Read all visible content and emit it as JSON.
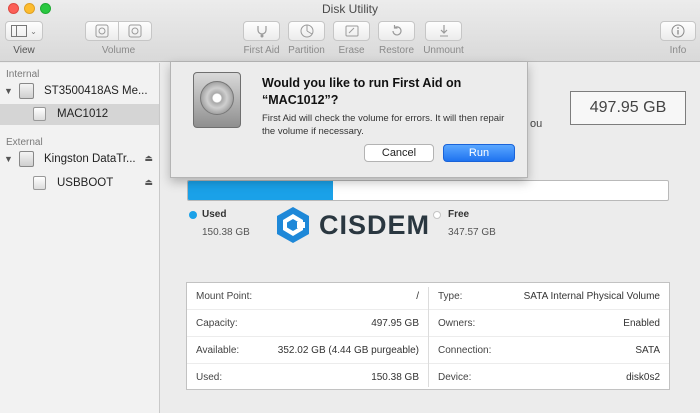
{
  "window": {
    "title": "Disk Utility"
  },
  "toolbar": {
    "view_label": "View",
    "volume_label": "Volume",
    "first_aid_label": "First Aid",
    "partition_label": "Partition",
    "erase_label": "Erase",
    "restore_label": "Restore",
    "unmount_label": "Unmount",
    "info_label": "Info"
  },
  "sidebar": {
    "internal_header": "Internal",
    "external_header": "External",
    "internal_disk": "ST3500418AS Me...",
    "internal_volume": "MAC1012",
    "external_disk": "Kingston DataTr...",
    "external_volume": "USBBOOT"
  },
  "main": {
    "capacity_display": "497.95 GB",
    "partial_text": "ou",
    "usage": {
      "used_fraction": 0.302,
      "used_label": "Used",
      "used_value": "150.38 GB",
      "free_label": "Free",
      "free_value": "347.57 GB",
      "used_color": "#1aa1e8",
      "free_color": "#ffffff"
    },
    "watermark": "CISDEM",
    "info_left": [
      {
        "key": "Mount Point:",
        "value": "/"
      },
      {
        "key": "Capacity:",
        "value": "497.95 GB"
      },
      {
        "key": "Available:",
        "value": "352.02 GB (4.44 GB purgeable)"
      },
      {
        "key": "Used:",
        "value": "150.38 GB"
      }
    ],
    "info_right": [
      {
        "key": "Type:",
        "value": "SATA Internal Physical Volume"
      },
      {
        "key": "Owners:",
        "value": "Enabled"
      },
      {
        "key": "Connection:",
        "value": "SATA"
      },
      {
        "key": "Device:",
        "value": "disk0s2"
      }
    ]
  },
  "dialog": {
    "title": "Would you like to run First Aid on “MAC1012”?",
    "body": "First Aid will check the volume for errors. It will then repair the volume if necessary.",
    "cancel_label": "Cancel",
    "run_label": "Run"
  }
}
